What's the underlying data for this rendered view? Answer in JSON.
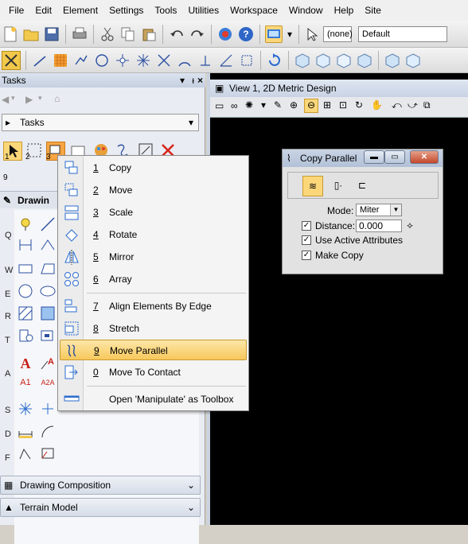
{
  "menubar": {
    "items": [
      "File",
      "Edit",
      "Element",
      "Settings",
      "Tools",
      "Utilities",
      "Workspace",
      "Window",
      "Help",
      "Site"
    ]
  },
  "toolbar1": {
    "level_value": "(none)",
    "style_value": "Default"
  },
  "tasks": {
    "title": "Tasks",
    "combo_value": "Tasks",
    "tool_numbers": [
      "1",
      "2",
      "3",
      "9"
    ],
    "drawing_label": "Drawin",
    "row_letters": [
      "Q",
      "W",
      "E",
      "R",
      "T",
      "A",
      "S",
      "D",
      "F"
    ],
    "sections": [
      "Drawing Composition",
      "Terrain Model"
    ]
  },
  "view": {
    "title": "View 1, 2D Metric Design"
  },
  "copy_parallel": {
    "title": "Copy Parallel",
    "mode_label": "Mode:",
    "mode_value": "Miter",
    "distance_label": "Distance:",
    "distance_value": "0.000",
    "use_active_label": "Use Active Attributes",
    "make_copy_label": "Make Copy",
    "distance_checked": true,
    "use_active_checked": true,
    "make_copy_checked": true
  },
  "manipulate_menu": {
    "items": [
      {
        "num": "1",
        "label": "Copy"
      },
      {
        "num": "2",
        "label": "Move"
      },
      {
        "num": "3",
        "label": "Scale"
      },
      {
        "num": "4",
        "label": "Rotate"
      },
      {
        "num": "5",
        "label": "Mirror"
      },
      {
        "num": "6",
        "label": "Array"
      },
      {
        "num": "7",
        "label": "Align Elements By Edge"
      },
      {
        "num": "8",
        "label": "Stretch"
      },
      {
        "num": "9",
        "label": "Move Parallel"
      },
      {
        "num": "0",
        "label": "Move To Contact"
      }
    ],
    "footer": "Open 'Manipulate' as Toolbox",
    "highlighted_index": 8,
    "highlight_color": "#f7c85c"
  }
}
